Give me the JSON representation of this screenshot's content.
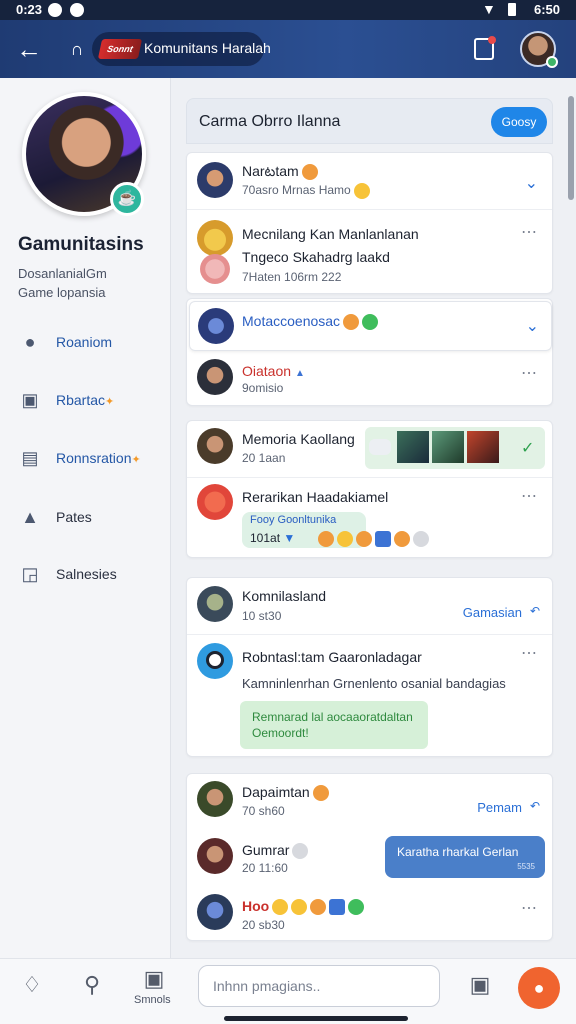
{
  "status_bar": {
    "time": "0:23",
    "right": "6:50"
  },
  "app_bar": {
    "logo_text": "Sonnt",
    "title": "Komunitans Haralah"
  },
  "profile": {
    "name": "Gamunitasins",
    "sub1": "DosanlanialGm",
    "sub2": "Game lopansia"
  },
  "sidebar": {
    "items": [
      {
        "label": "Roaniom",
        "icon": "user-icon"
      },
      {
        "label": "Rbartac",
        "icon": "image-icon"
      },
      {
        "label": "Ronnsration",
        "icon": "folder-icon"
      },
      {
        "label": "Pates",
        "icon": "pin-icon"
      },
      {
        "label": "Salnesies",
        "icon": "frame-icon"
      }
    ]
  },
  "feed_header": {
    "title": "Carma Obrro Ilanna",
    "button": "Goosy"
  },
  "card1": {
    "r1": {
      "name": "Narటtam",
      "meta": "70asro Mrnas Hamo"
    },
    "r2": {
      "name": "Mecnilang Kan Manlanlanan",
      "line2": "Tngeco Skahadrg laakd",
      "meta": "7Haten 106rm 222"
    }
  },
  "card2": {
    "r1": {
      "name": "Motaccoenosac"
    },
    "r2": {
      "name": "Oiataon",
      "meta": "9omisio"
    }
  },
  "card3": {
    "r1": {
      "name": "Memoria Kaollang",
      "meta": "20 1aan"
    },
    "r2": {
      "name": "Rerarikan Haadakiamel",
      "pill_top": "Fooy  Goonltunika",
      "pill_bottom": "101at"
    }
  },
  "card4": {
    "r1": {
      "name": "Komnilasland",
      "meta": "10 st30",
      "link": "Gamasian"
    },
    "r2": {
      "name": "Robntasl:tam Gaaronladagar",
      "text": "Kamninlenrhan Grnenlento osanial bandagias",
      "bubble": "Remnarad lal aocaaoratdaltan Oemoordt!"
    }
  },
  "card5": {
    "r1": {
      "name": "Dapaimtan",
      "meta": "70 sh60",
      "link": "Pemam"
    },
    "r2": {
      "name": "Gumrar",
      "meta": "20 11:60",
      "bubble": "Karatha rharkal Gerlan",
      "bubble_meta": "5535"
    },
    "r3": {
      "name": "Hoo",
      "meta": "20 sb30"
    }
  },
  "bottom_nav": {
    "label": "Smnols",
    "input_placeholder": "Inhnn pmagians.."
  }
}
